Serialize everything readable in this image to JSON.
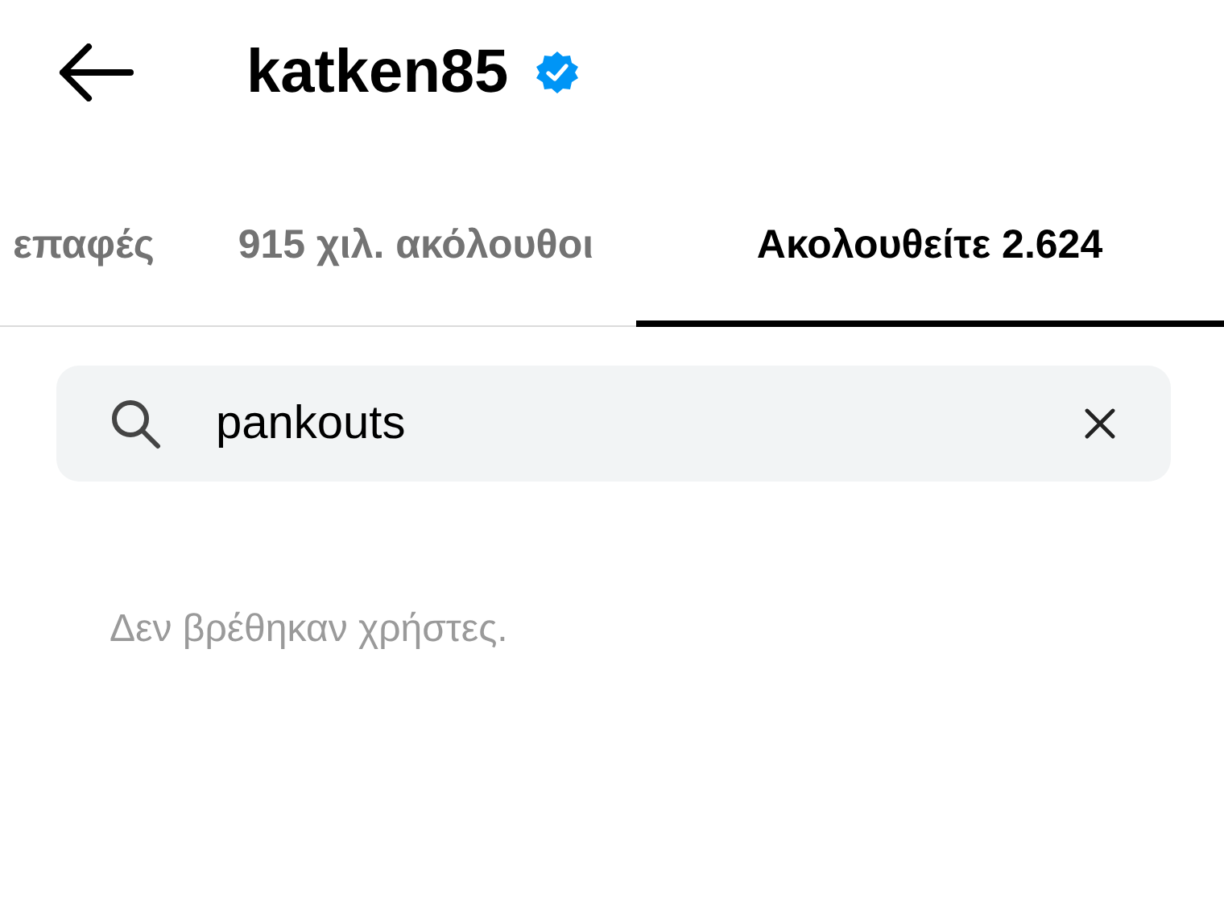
{
  "header": {
    "title": "katken85",
    "verified": true
  },
  "tabs": [
    {
      "label": "επαφές",
      "selected": false
    },
    {
      "label": "915 χιλ. ακόλουθοι",
      "selected": false
    },
    {
      "label": "Ακολουθείτε 2.624",
      "selected": true
    }
  ],
  "search": {
    "value": "pankouts"
  },
  "empty_message": "Δεν βρέθηκαν χρήστες."
}
